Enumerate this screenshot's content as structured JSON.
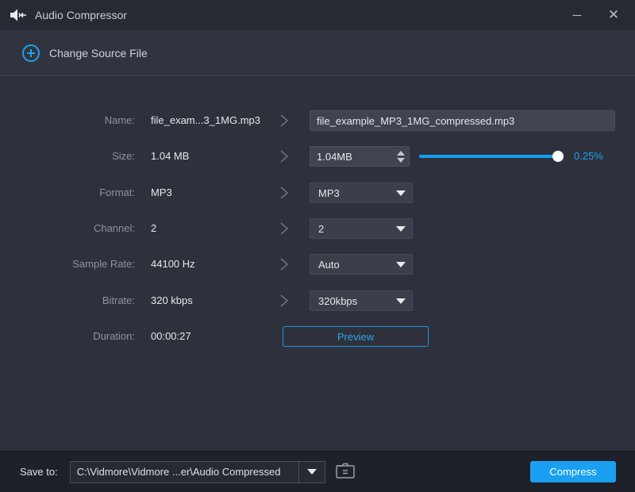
{
  "window": {
    "title": "Audio Compressor",
    "minimize_glyph": "─",
    "close_glyph": "✕"
  },
  "header": {
    "change_source_label": "Change Source File"
  },
  "rows": [
    {
      "label": "Name:",
      "value": "file_exam...3_1MG.mp3",
      "control_type": "text",
      "control_value": "file_example_MP3_1MG_compressed.mp3"
    },
    {
      "label": "Size:",
      "value": "1.04 MB",
      "control_type": "spinner",
      "control_value": "1.04MB",
      "slider_percent_label": "0.25%",
      "slider_position": 0.96
    },
    {
      "label": "Format:",
      "value": "MP3",
      "control_type": "dropdown",
      "control_value": "MP3"
    },
    {
      "label": "Channel:",
      "value": "2",
      "control_type": "dropdown",
      "control_value": "2"
    },
    {
      "label": "Sample Rate:",
      "value": "44100 Hz",
      "control_type": "dropdown",
      "control_value": "Auto"
    },
    {
      "label": "Bitrate:",
      "value": "320 kbps",
      "control_type": "dropdown",
      "control_value": "320kbps"
    },
    {
      "label": "Duration:",
      "value": "00:00:27",
      "control_type": "button",
      "control_value": "Preview"
    }
  ],
  "footer": {
    "save_to_label": "Save to:",
    "path": "C:\\Vidmore\\Vidmore ...er\\Audio Compressed",
    "compress_label": "Compress"
  },
  "colors": {
    "accent_blue": "#1b9ff0",
    "titlebar_bg": "#272a33",
    "header_bg": "#31343f",
    "body_bg": "#2e313b",
    "footer_bg": "#1e212a",
    "input_bg": "#3f4450",
    "dropdown_bg": "#3a3f4a",
    "label_gray": "#8f939d",
    "percent_blue": "#16a2f1"
  }
}
